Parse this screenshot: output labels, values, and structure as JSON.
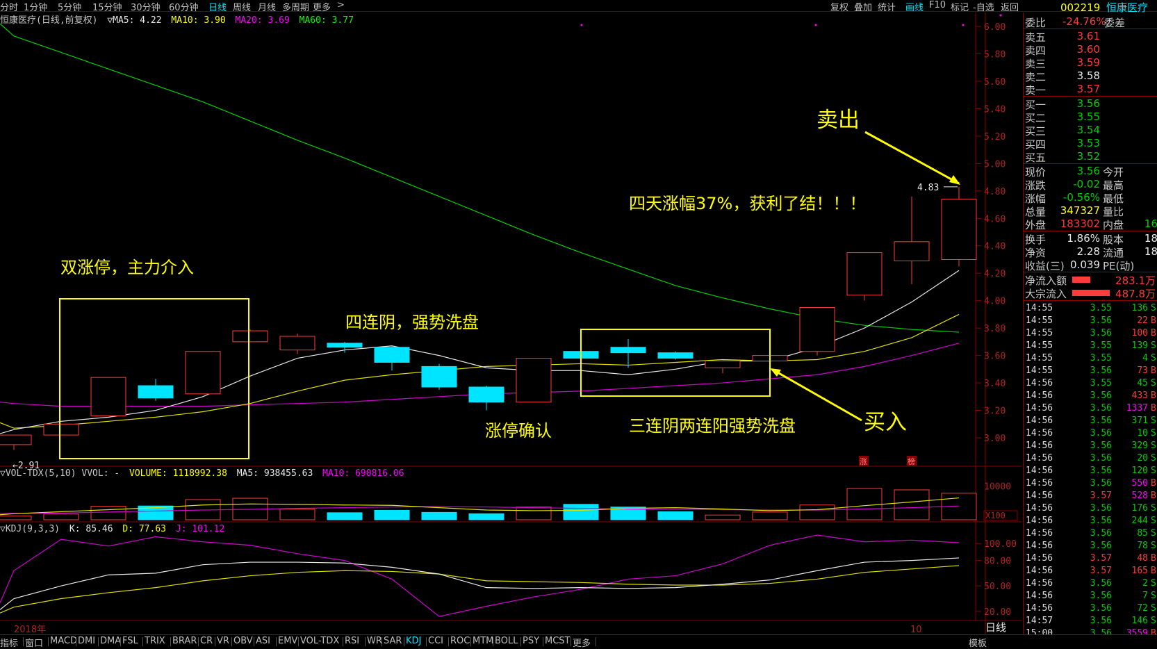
{
  "periods": [
    "分时",
    "1分钟",
    "5分钟",
    "15分钟",
    "30分钟",
    "60分钟",
    "日线",
    "周线",
    "月线",
    "多周期",
    "更多",
    ">"
  ],
  "active_period": "日线",
  "toolbar": [
    "复权",
    "叠加",
    "统计",
    "画线",
    "F10",
    "标记",
    "-自选",
    "返回"
  ],
  "active_tool": "画线",
  "stock": {
    "code": "002219",
    "name": "恒康医疗"
  },
  "chart_header": {
    "title": "恒康医疗(日线,前复权)",
    "ma5": "▽MA5: 4.22",
    "ma10": "MA10: 3.90",
    "ma20": "MA20: 3.69",
    "ma60": "MA60: 3.77"
  },
  "price_axis": [
    "6.00",
    "5.80",
    "5.60",
    "5.40",
    "5.20",
    "5.00",
    "4.80",
    "4.60",
    "4.40",
    "4.20",
    "4.00",
    "3.80",
    "3.60",
    "3.40",
    "3.20",
    "3.00"
  ],
  "price_labels": {
    "high": "4.83",
    "low": "2.91"
  },
  "annotations": {
    "sell": "卖出",
    "gain": "四天涨幅37%，获利了结！！！",
    "double_limit": "双涨停，主力介入",
    "four_down": "四连阴，强势洗盘",
    "limit_confirm": "涨停确认",
    "three_down_two_up": "三连阴两连阳强势洗盘",
    "buy": "买入"
  },
  "markers": [
    "涨",
    "榜"
  ],
  "volume_header": {
    "title": "▽VOL-TDX(5,10) VVOL: -",
    "volume": "VOLUME: 1118992.38",
    "ma5": "MA5: 938455.63",
    "ma10": "MA10: 690816.06"
  },
  "volume_axis": {
    "top": "10000",
    "unit": "X100"
  },
  "kdj_header": {
    "title": "▽KDJ(9,3,3)",
    "k": "K: 85.46",
    "d": "D: 77.63",
    "j": "J: 101.12"
  },
  "kdj_axis": [
    "100.00",
    "80.00",
    "50.00",
    "20.00"
  ],
  "date_labels": {
    "year": "2018年",
    "month": "10",
    "period": "日线"
  },
  "bottom_tabs": [
    "指标",
    "窗口",
    "MACD",
    "DMI",
    "DMA",
    "FSL",
    "TRIX",
    "BRAR",
    "CR",
    "VR",
    "OBV",
    "ASI",
    "EMV",
    "VOL-TDX",
    "RSI",
    "WR",
    "SAR",
    "KDJ",
    "CCI",
    "ROC",
    "MTM",
    "BOLL",
    "PSY",
    "MCST",
    "更多"
  ],
  "active_tab": "KDJ",
  "bottom_right": "模板",
  "quote": {
    "weibi": {
      "label": "委比",
      "value": "-24.76%",
      "extra": "委差"
    },
    "asks": [
      {
        "label": "卖五",
        "price": "3.61"
      },
      {
        "label": "卖四",
        "price": "3.60"
      },
      {
        "label": "卖三",
        "price": "3.59"
      },
      {
        "label": "卖二",
        "price": "3.58"
      },
      {
        "label": "卖一",
        "price": "3.57"
      }
    ],
    "bids": [
      {
        "label": "买一",
        "price": "3.56"
      },
      {
        "label": "买二",
        "price": "3.55"
      },
      {
        "label": "买三",
        "price": "3.54"
      },
      {
        "label": "买四",
        "price": "3.53"
      },
      {
        "label": "买五",
        "price": "3.52"
      }
    ],
    "stats": [
      {
        "l1": "现价",
        "v1": "3.56",
        "l2": "今开",
        "v2": ""
      },
      {
        "l1": "涨跌",
        "v1": "-0.02",
        "l2": "最高",
        "v2": ""
      },
      {
        "l1": "涨幅",
        "v1": "-0.56%",
        "l2": "最低",
        "v2": ""
      },
      {
        "l1": "总量",
        "v1": "347327",
        "l2": "量比",
        "v2": ""
      },
      {
        "l1": "外盘",
        "v1": "183302",
        "l2": "内盘",
        "v2": "16"
      }
    ],
    "stats2": [
      {
        "l1": "换手",
        "v1": "1.86%",
        "l2": "股本",
        "v2": "18"
      },
      {
        "l1": "净资",
        "v1": "2.28",
        "l2": "流通",
        "v2": "18"
      },
      {
        "l1": "收益(三)",
        "v1": "0.039",
        "l2": "PE(动)",
        "v2": ""
      }
    ],
    "flows": [
      {
        "label": "净流入额",
        "value": "283.1万"
      },
      {
        "label": "大宗流入",
        "value": "487.8万"
      }
    ]
  },
  "ticks": [
    {
      "t": "14:55",
      "p": "3.55",
      "v": "136",
      "f": "S"
    },
    {
      "t": "14:55",
      "p": "3.56",
      "v": "22",
      "f": "B"
    },
    {
      "t": "14:55",
      "p": "3.56",
      "v": "100",
      "f": "B"
    },
    {
      "t": "14:55",
      "p": "3.55",
      "v": "139",
      "f": "S"
    },
    {
      "t": "14:55",
      "p": "3.55",
      "v": "4",
      "f": "S"
    },
    {
      "t": "14:55",
      "p": "3.56",
      "v": "73",
      "f": "B"
    },
    {
      "t": "14:56",
      "p": "3.55",
      "v": "45",
      "f": "S"
    },
    {
      "t": "14:56",
      "p": "3.56",
      "v": "433",
      "f": "B"
    },
    {
      "t": "14:56",
      "p": "3.56",
      "v": "1337",
      "f": "B"
    },
    {
      "t": "14:56",
      "p": "3.56",
      "v": "371",
      "f": "S"
    },
    {
      "t": "14:56",
      "p": "3.56",
      "v": "10",
      "f": "S"
    },
    {
      "t": "14:56",
      "p": "3.56",
      "v": "329",
      "f": "S"
    },
    {
      "t": "14:56",
      "p": "3.56",
      "v": "20",
      "f": "S"
    },
    {
      "t": "14:56",
      "p": "3.56",
      "v": "120",
      "f": "S"
    },
    {
      "t": "14:56",
      "p": "3.56",
      "v": "550",
      "f": "B"
    },
    {
      "t": "14:56",
      "p": "3.57",
      "v": "528",
      "f": "B"
    },
    {
      "t": "14:56",
      "p": "3.56",
      "v": "176",
      "f": "S"
    },
    {
      "t": "14:56",
      "p": "3.56",
      "v": "244",
      "f": "S"
    },
    {
      "t": "14:56",
      "p": "3.56",
      "v": "85",
      "f": "S"
    },
    {
      "t": "14:56",
      "p": "3.56",
      "v": "78",
      "f": "S"
    },
    {
      "t": "14:56",
      "p": "3.57",
      "v": "48",
      "f": "B"
    },
    {
      "t": "14:56",
      "p": "3.57",
      "v": "165",
      "f": "B"
    },
    {
      "t": "14:56",
      "p": "3.56",
      "v": "2",
      "f": "S"
    },
    {
      "t": "14:56",
      "p": "3.56",
      "v": "7",
      "f": "S"
    },
    {
      "t": "14:56",
      "p": "3.56",
      "v": "72",
      "f": "S"
    },
    {
      "t": "14:57",
      "p": "3.56",
      "v": "146",
      "f": "S"
    },
    {
      "t": "15:00",
      "p": "3.56",
      "v": "3559",
      "f": "B"
    }
  ],
  "chart_data": {
    "type": "candlestick",
    "title": "恒康医疗(日线,前复权)",
    "ylim": [
      2.8,
      6.1
    ],
    "candles": [
      {
        "o": 2.95,
        "c": 3.02,
        "h": 3.02,
        "l": 2.91,
        "dir": "up"
      },
      {
        "o": 3.02,
        "c": 3.1,
        "h": 3.1,
        "l": 3.02,
        "dir": "up"
      },
      {
        "o": 3.16,
        "c": 3.44,
        "h": 3.44,
        "l": 3.16,
        "dir": "up"
      },
      {
        "o": 3.38,
        "c": 3.29,
        "h": 3.43,
        "l": 3.27,
        "dir": "down"
      },
      {
        "o": 3.32,
        "c": 3.63,
        "h": 3.63,
        "l": 3.32,
        "dir": "up"
      },
      {
        "o": 3.7,
        "c": 3.78,
        "h": 3.79,
        "l": 3.7,
        "dir": "up"
      },
      {
        "o": 3.64,
        "c": 3.74,
        "h": 3.76,
        "l": 3.61,
        "dir": "up"
      },
      {
        "o": 3.69,
        "c": 3.66,
        "h": 3.7,
        "l": 3.62,
        "dir": "down"
      },
      {
        "o": 3.66,
        "c": 3.55,
        "h": 3.67,
        "l": 3.49,
        "dir": "down"
      },
      {
        "o": 3.52,
        "c": 3.37,
        "h": 3.54,
        "l": 3.35,
        "dir": "down"
      },
      {
        "o": 3.37,
        "c": 3.26,
        "h": 3.38,
        "l": 3.2,
        "dir": "down"
      },
      {
        "o": 3.26,
        "c": 3.58,
        "h": 3.58,
        "l": 3.26,
        "dir": "up"
      },
      {
        "o": 3.63,
        "c": 3.58,
        "h": 3.63,
        "l": 3.58,
        "dir": "down"
      },
      {
        "o": 3.66,
        "c": 3.62,
        "h": 3.72,
        "l": 3.51,
        "dir": "down"
      },
      {
        "o": 3.62,
        "c": 3.58,
        "h": 3.63,
        "l": 3.57,
        "dir": "down"
      },
      {
        "o": 3.51,
        "c": 3.56,
        "h": 3.56,
        "l": 3.47,
        "dir": "up"
      },
      {
        "o": 3.56,
        "c": 3.6,
        "h": 3.61,
        "l": 3.55,
        "dir": "up"
      },
      {
        "o": 3.63,
        "c": 3.95,
        "h": 3.95,
        "l": 3.6,
        "dir": "up"
      },
      {
        "o": 4.04,
        "c": 4.35,
        "h": 4.35,
        "l": 4.0,
        "dir": "up"
      },
      {
        "o": 4.29,
        "c": 4.43,
        "h": 4.76,
        "l": 4.12,
        "dir": "up"
      },
      {
        "o": 4.3,
        "c": 4.74,
        "h": 4.83,
        "l": 4.25,
        "dir": "up"
      }
    ],
    "ma5": [
      3.03,
      3.06,
      3.12,
      3.15,
      3.2,
      3.3,
      3.45,
      3.58,
      3.64,
      3.67,
      3.6,
      3.51,
      3.49,
      3.49,
      3.46,
      3.5,
      3.56,
      3.56,
      3.66,
      3.8,
      3.99,
      4.22
    ],
    "ma10": [
      3.11,
      3.07,
      3.09,
      3.12,
      3.15,
      3.19,
      3.25,
      3.34,
      3.42,
      3.46,
      3.49,
      3.52,
      3.53,
      3.54,
      3.53,
      3.55,
      3.57,
      3.56,
      3.57,
      3.63,
      3.73,
      3.9
    ],
    "ma20": [
      3.26,
      3.25,
      3.23,
      3.23,
      3.23,
      3.23,
      3.24,
      3.25,
      3.26,
      3.28,
      3.3,
      3.32,
      3.33,
      3.34,
      3.36,
      3.38,
      3.4,
      3.43,
      3.46,
      3.52,
      3.6,
      3.69
    ],
    "ma60": [
      6.02,
      5.93,
      5.81,
      5.69,
      5.57,
      5.45,
      5.31,
      5.17,
      5.04,
      4.9,
      4.76,
      4.62,
      4.48,
      4.35,
      4.23,
      4.11,
      4.02,
      3.94,
      3.87,
      3.82,
      3.79,
      3.77
    ],
    "volume_ylim": [
      0,
      12000
    ],
    "volume": [
      {
        "v": 1100,
        "dir": "up"
      },
      {
        "v": 1700,
        "dir": "up"
      },
      {
        "v": 4000,
        "dir": "up"
      },
      {
        "v": 4100,
        "dir": "down"
      },
      {
        "v": 6000,
        "dir": "up"
      },
      {
        "v": 6400,
        "dir": "up"
      },
      {
        "v": 3200,
        "dir": "up"
      },
      {
        "v": 2100,
        "dir": "down"
      },
      {
        "v": 2800,
        "dir": "down"
      },
      {
        "v": 2200,
        "dir": "down"
      },
      {
        "v": 1800,
        "dir": "down"
      },
      {
        "v": 3800,
        "dir": "up"
      },
      {
        "v": 4600,
        "dir": "down"
      },
      {
        "v": 3800,
        "dir": "down"
      },
      {
        "v": 2400,
        "dir": "down"
      },
      {
        "v": 1400,
        "dir": "up"
      },
      {
        "v": 2300,
        "dir": "up"
      },
      {
        "v": 4400,
        "dir": "up"
      },
      {
        "v": 9300,
        "dir": "up"
      },
      {
        "v": 8900,
        "dir": "up"
      },
      {
        "v": 7900,
        "dir": "up"
      }
    ],
    "vol_ma5": [
      1500,
      1800,
      2400,
      3000,
      3600,
      4400,
      4700,
      4600,
      4400,
      4300,
      3600,
      2900,
      2700,
      2800,
      3400,
      3600,
      3200,
      2700,
      3000,
      4200,
      5300,
      6500
    ],
    "vol_ma10": [
      1800,
      1900,
      2000,
      2300,
      2600,
      2900,
      3100,
      3400,
      3600,
      3800,
      3900,
      3800,
      3600,
      3400,
      3200,
      3100,
      3000,
      2900,
      2900,
      3200,
      3600,
      4100
    ],
    "kdj_ylim": [
      10,
      110
    ],
    "k": [
      22,
      35,
      50,
      63,
      65,
      75,
      78,
      78,
      77,
      72,
      64,
      48,
      47,
      48,
      47,
      48,
      52,
      57,
      68,
      78,
      80,
      83
    ],
    "d": [
      18,
      25,
      35,
      42,
      48,
      56,
      62,
      66,
      68,
      67,
      64,
      56,
      55,
      54,
      52,
      51,
      51,
      53,
      58,
      66,
      70,
      74
    ],
    "j": [
      30,
      68,
      105,
      97,
      108,
      102,
      98,
      88,
      80,
      58,
      14,
      26,
      37,
      46,
      58,
      62,
      76,
      98,
      110,
      102,
      104,
      101
    ]
  }
}
